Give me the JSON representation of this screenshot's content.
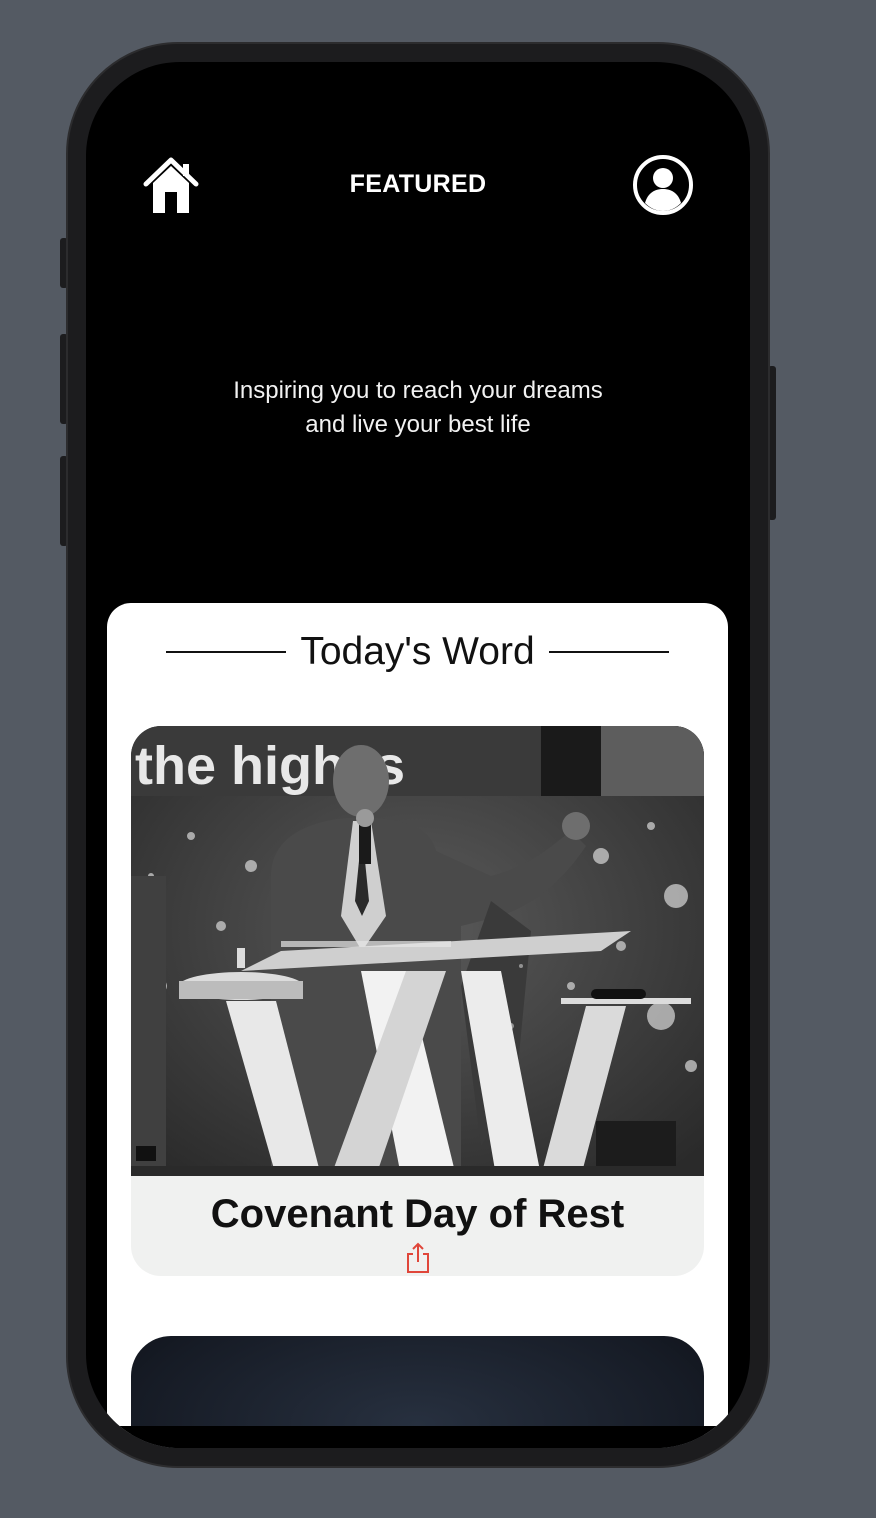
{
  "header": {
    "title": "FEATURED",
    "home_icon": "home-icon",
    "profile_icon": "user-circle-icon"
  },
  "tagline": {
    "line1": "Inspiring you to reach your dreams",
    "line2": "and live your best life"
  },
  "todays_word": {
    "heading": "Today's Word",
    "card": {
      "image_text": "the highes",
      "title": "Covenant Day of Rest",
      "share_icon": "share-icon"
    }
  },
  "colors": {
    "background": "#545a63",
    "screen": "#000000",
    "sheet": "#ffffff",
    "card_footer": "#f0f1f0",
    "share_accent": "#e0463a"
  }
}
